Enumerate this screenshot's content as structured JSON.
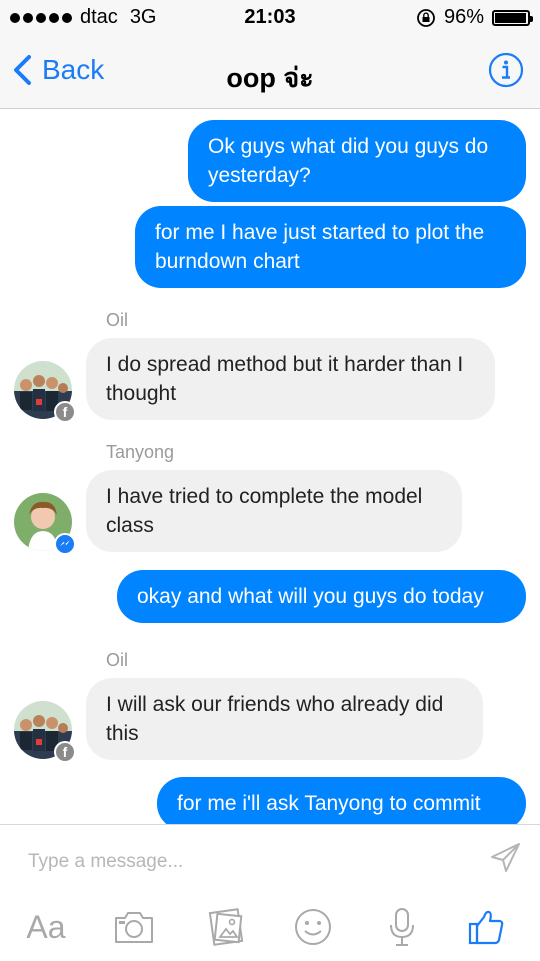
{
  "status": {
    "carrier": "dtac",
    "network": "3G",
    "time": "21:03",
    "battery": "96%"
  },
  "nav": {
    "back_label": "Back",
    "title": "oop จ่ะ"
  },
  "messages": [
    {
      "type": "outgoing",
      "text": "Ok guys what did you guys do yesterday?"
    },
    {
      "type": "outgoing",
      "text": "for me I have just started to plot the burndown chart"
    },
    {
      "type": "incoming",
      "sender": "Oil",
      "text": "I do spread method but it harder than I thought",
      "badge": "facebook-icon"
    },
    {
      "type": "incoming",
      "sender": "Tanyong",
      "text": "I have tried to complete the model class",
      "badge": "messenger-icon"
    },
    {
      "type": "outgoing",
      "text": "okay and what will you guys do today"
    },
    {
      "type": "incoming",
      "sender": "Oil",
      "text": "I will ask our friends who already did this",
      "badge": "facebook-icon"
    },
    {
      "type": "outgoing",
      "text": "for me i'll ask Tanyong to commit"
    }
  ],
  "composer": {
    "placeholder": "Type a message...",
    "text_tool_label": "Aa",
    "tools": [
      "text-size-icon",
      "camera-icon",
      "gallery-icon",
      "emoji-icon",
      "microphone-icon",
      "like-icon"
    ]
  },
  "colors": {
    "accent": "#1a7cf6",
    "outgoing_bubble": "#0084ff",
    "incoming_bubble": "#f1f0f0"
  }
}
